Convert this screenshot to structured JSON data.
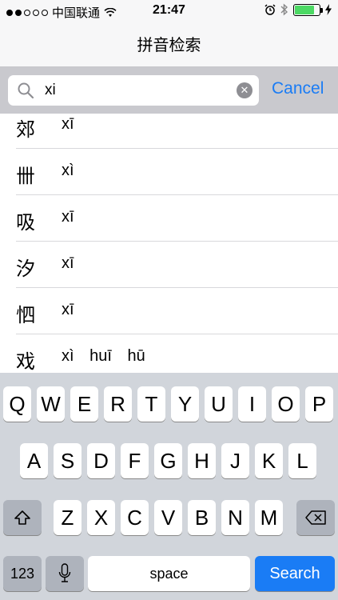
{
  "status_bar": {
    "carrier": "中国联通",
    "time": "21:47",
    "battery_color": "#4cd964"
  },
  "nav": {
    "title": "拼音检索"
  },
  "search": {
    "value": "xi",
    "cancel_label": "Cancel",
    "icon": "magnifier-icon",
    "clear_icon": "clear-circle-icon"
  },
  "results": [
    {
      "hanzi": "郊",
      "pinyin": "xī"
    },
    {
      "hanzi": "卌",
      "pinyin": "xì"
    },
    {
      "hanzi": "吸",
      "pinyin": "xī"
    },
    {
      "hanzi": "汐",
      "pinyin": "xī"
    },
    {
      "hanzi": "怬",
      "pinyin": "xī"
    },
    {
      "hanzi": "戏",
      "pinyin": "xì huī hū"
    }
  ],
  "keyboard": {
    "row1": [
      "Q",
      "W",
      "E",
      "R",
      "T",
      "Y",
      "U",
      "I",
      "O",
      "P"
    ],
    "row2": [
      "A",
      "S",
      "D",
      "F",
      "G",
      "H",
      "J",
      "K",
      "L"
    ],
    "row3": [
      "Z",
      "X",
      "C",
      "V",
      "B",
      "N",
      "M"
    ],
    "numbers_label": "123",
    "space_label": "space",
    "search_label": "Search",
    "accent_color": "#1a7cf5"
  }
}
